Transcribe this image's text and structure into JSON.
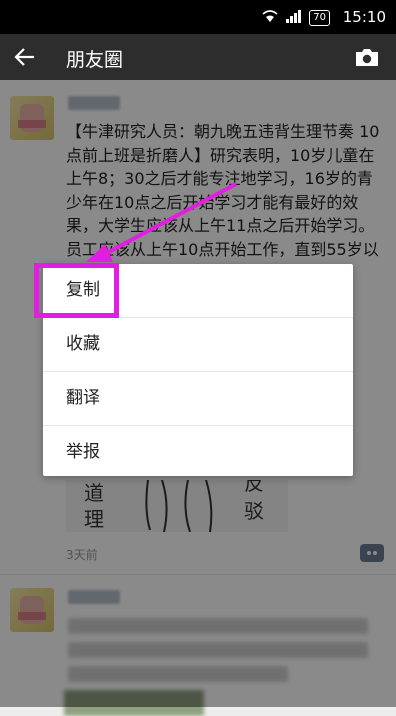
{
  "status_bar": {
    "time": "15:10",
    "battery": "70"
  },
  "header": {
    "title": "朋友圈"
  },
  "post": {
    "text": "【牛津研究人员：朝九晚五违背生理节奏 10点前上班是折磨人】研究表明，10岁儿童在上午8；30之后才能专注地学习，16岁的青少年在10点之后开始学习才能有最好的效果，大学生应该从上午11点之后开始学习。员工应该从上午10点开始工作，直到55岁以后再调回到上午9点开始工作。",
    "time": "3天前"
  },
  "context_menu": {
    "items": [
      "复制",
      "收藏",
      "翻译",
      "举报"
    ]
  },
  "colors": {
    "highlight": "#e21ee0",
    "header_bg": "#2d2d2d"
  }
}
